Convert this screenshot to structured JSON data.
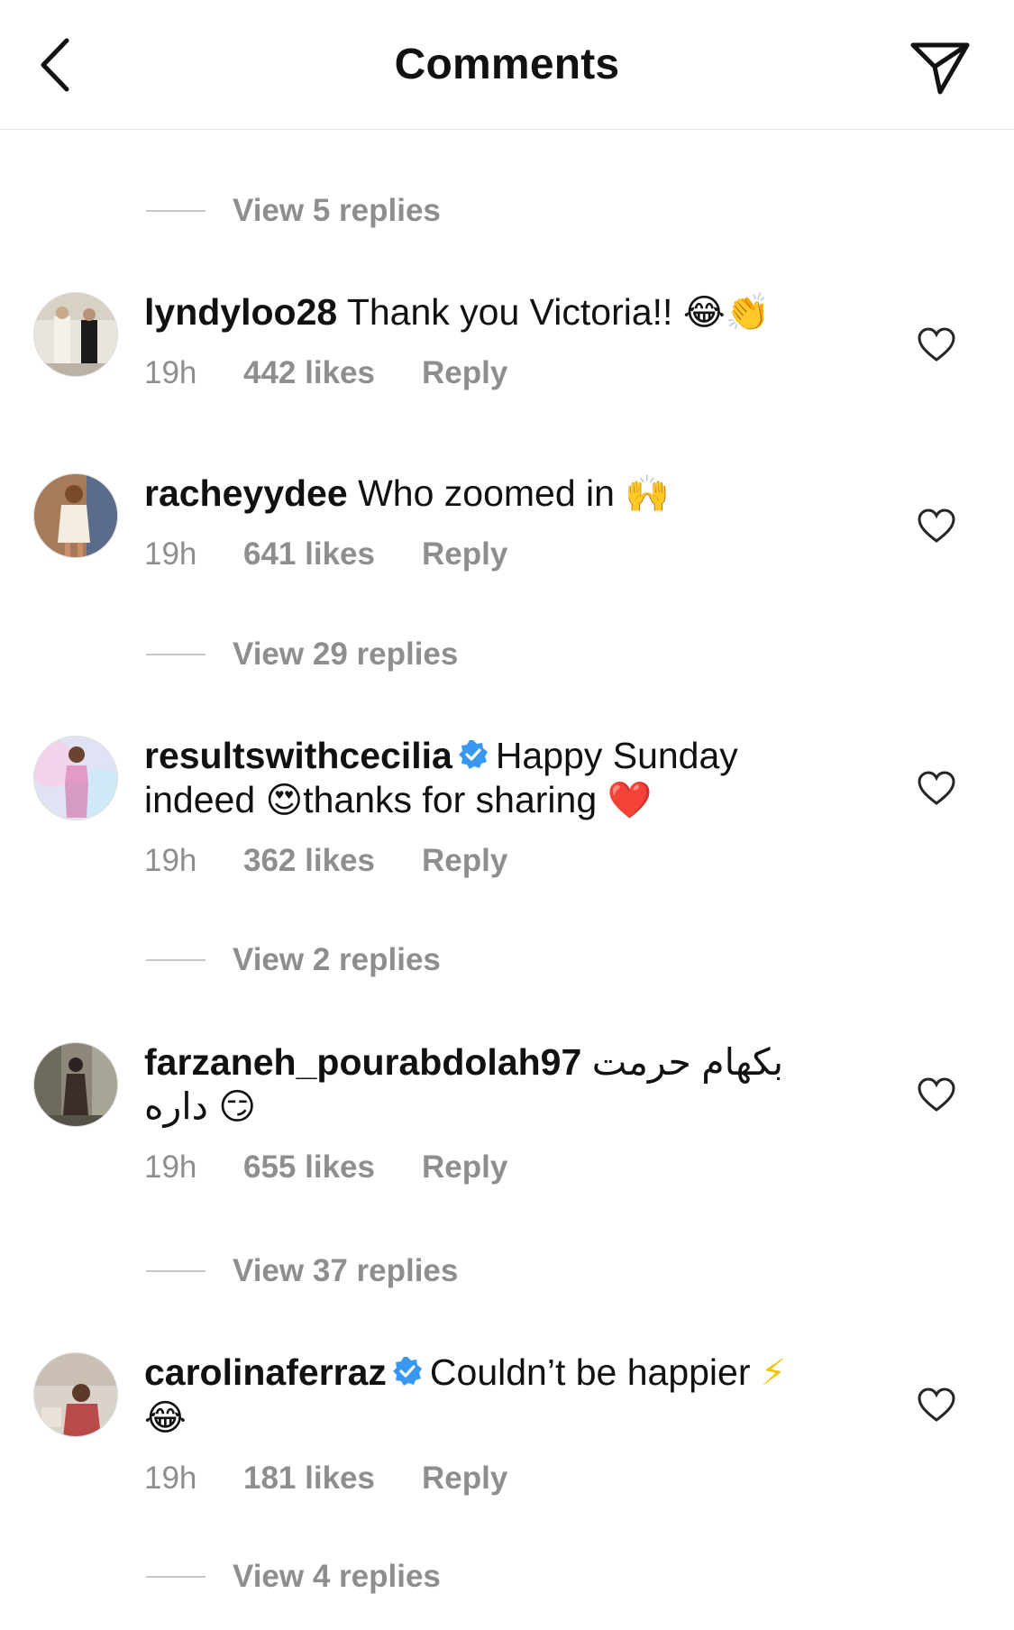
{
  "header": {
    "title": "Comments"
  },
  "replies": [
    {
      "label": "View 5 replies"
    },
    {
      "label": "View 29 replies"
    },
    {
      "label": "View 2 replies"
    },
    {
      "label": "View 37 replies"
    },
    {
      "label": "View 4 replies"
    }
  ],
  "comments": [
    {
      "username": "lyndyloo28",
      "text": "Thank you Victoria!!",
      "emoji": "😂👏",
      "time": "19h",
      "likes": "442 likes",
      "reply": "Reply"
    },
    {
      "username": "racheyydee",
      "text": "Who zoomed in",
      "emoji": "🙌",
      "time": "19h",
      "likes": "641 likes",
      "reply": "Reply"
    },
    {
      "username": "resultswithcecilia",
      "verified": true,
      "text": "Happy Sunday indeed",
      "emoji1": "😍",
      "text2": "thanks for sharing",
      "emoji2": "❤️",
      "time": "19h",
      "likes": "362 likes",
      "reply": "Reply"
    },
    {
      "username": "farzaneh_pourabdolah97",
      "text": "بکهام حرمت داره",
      "emoji": "😏",
      "time": "19h",
      "likes": "655 likes",
      "reply": "Reply"
    },
    {
      "username": "carolinaferraz",
      "verified": true,
      "text": "Couldn’t be happier",
      "emoji1": "⚡",
      "emoji2": "😂",
      "time": "19h",
      "likes": "181 likes",
      "reply": "Reply"
    }
  ],
  "colors": {
    "text": "#111111",
    "secondary": "#8e8e8e",
    "verified": "#3897f0",
    "divider": "#c7c7c7"
  },
  "icons": {
    "back": "chevron-left-icon",
    "send": "paper-plane-icon",
    "like": "heart-outline-icon",
    "verified": "verified-badge-icon"
  }
}
